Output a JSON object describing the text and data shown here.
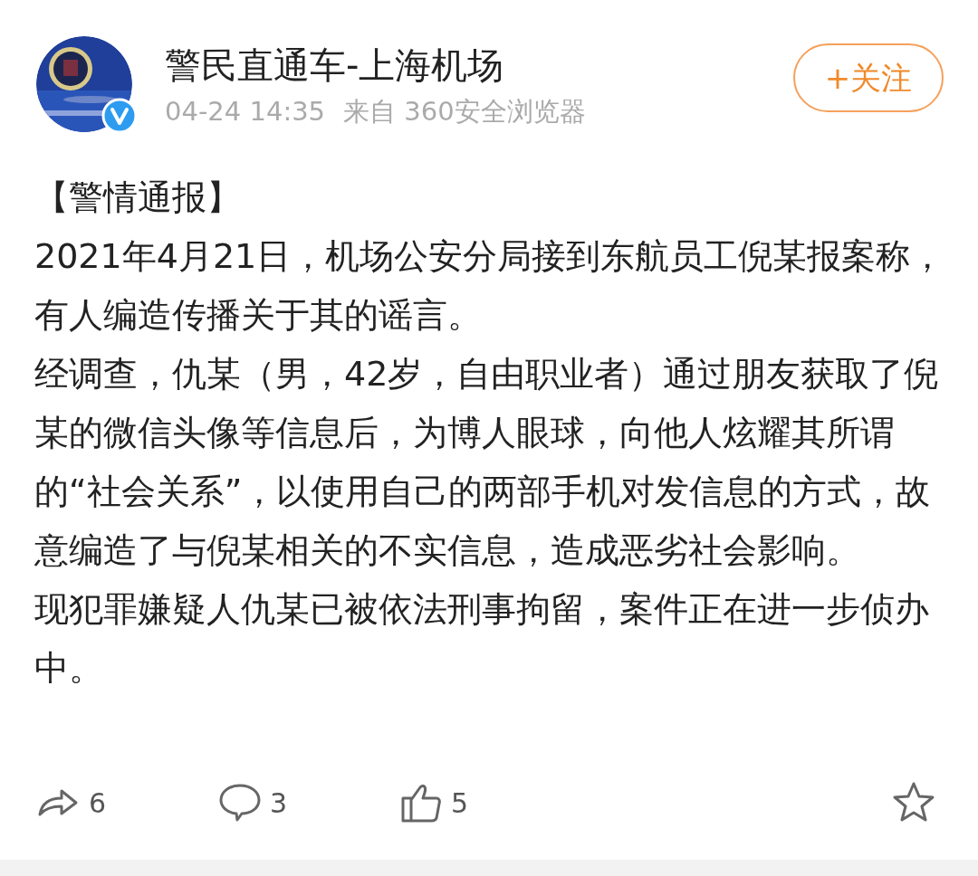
{
  "author": {
    "name": "警民直通车-上海机场",
    "verified": true,
    "time": "04-24 14:35",
    "source": "来自 360安全浏览器"
  },
  "follow_button": {
    "label": "+关注"
  },
  "post": {
    "title": "【警情通报】",
    "paragraphs": [
      "2021年4月21日，机场公安分局接到东航员工倪某报案称，有人编造传播关于其的谣言。",
      "经调查，仇某（男，42岁，自由职业者）通过朋友获取了倪某的微信头像等信息后，为博人眼球，向他人炫耀其所谓的“社会关系”，以使用自己的两部手机对发信息的方式，故意编造了与倪某相关的不实信息，造成恶劣社会影响。",
      "现犯罪嫌疑人仇某已被依法刑事拘留，案件正在进一步侦办中。"
    ]
  },
  "actions": [
    {
      "kind": "repost",
      "count": "6"
    },
    {
      "kind": "comment",
      "count": "3"
    },
    {
      "kind": "like",
      "count": "5"
    },
    {
      "kind": "favorite"
    }
  ]
}
